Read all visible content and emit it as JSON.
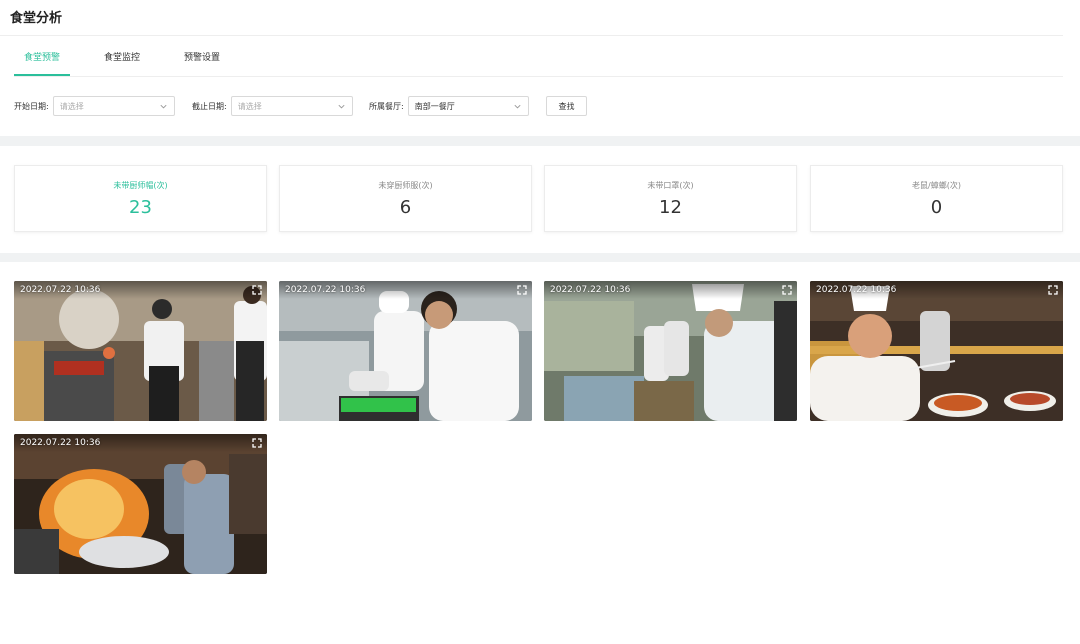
{
  "page": {
    "title": "食堂分析"
  },
  "tabs": [
    {
      "label": "食堂预警",
      "active": true
    },
    {
      "label": "食堂监控",
      "active": false
    },
    {
      "label": "预警设置",
      "active": false
    }
  ],
  "filters": {
    "start_date": {
      "label": "开始日期:",
      "placeholder": "请选择"
    },
    "end_date": {
      "label": "截止日期:",
      "placeholder": "请选择"
    },
    "restaurant": {
      "label": "所属餐厅:",
      "value": "南部一餐厅"
    },
    "search_label": "查找"
  },
  "stats": [
    {
      "label": "未带厨师帽(次)",
      "value": "23"
    },
    {
      "label": "未穿厨师服(次)",
      "value": "6"
    },
    {
      "label": "未带口罩(次)",
      "value": "12"
    },
    {
      "label": "老鼠/蟑螂(次)",
      "value": "0"
    }
  ],
  "captures": [
    {
      "timestamp": "2022.07.22  10:36"
    },
    {
      "timestamp": "2022.07.22  10:36"
    },
    {
      "timestamp": "2022.07.22  10:36"
    },
    {
      "timestamp": "2022.07.22  10:36"
    },
    {
      "timestamp": "2022.07.22  10:36"
    }
  ],
  "colors": {
    "accent": "#2bbf9b",
    "band": "#f0f2f3"
  },
  "icons": {
    "select": "chevron-down-icon",
    "capture": "fullscreen-icon"
  }
}
